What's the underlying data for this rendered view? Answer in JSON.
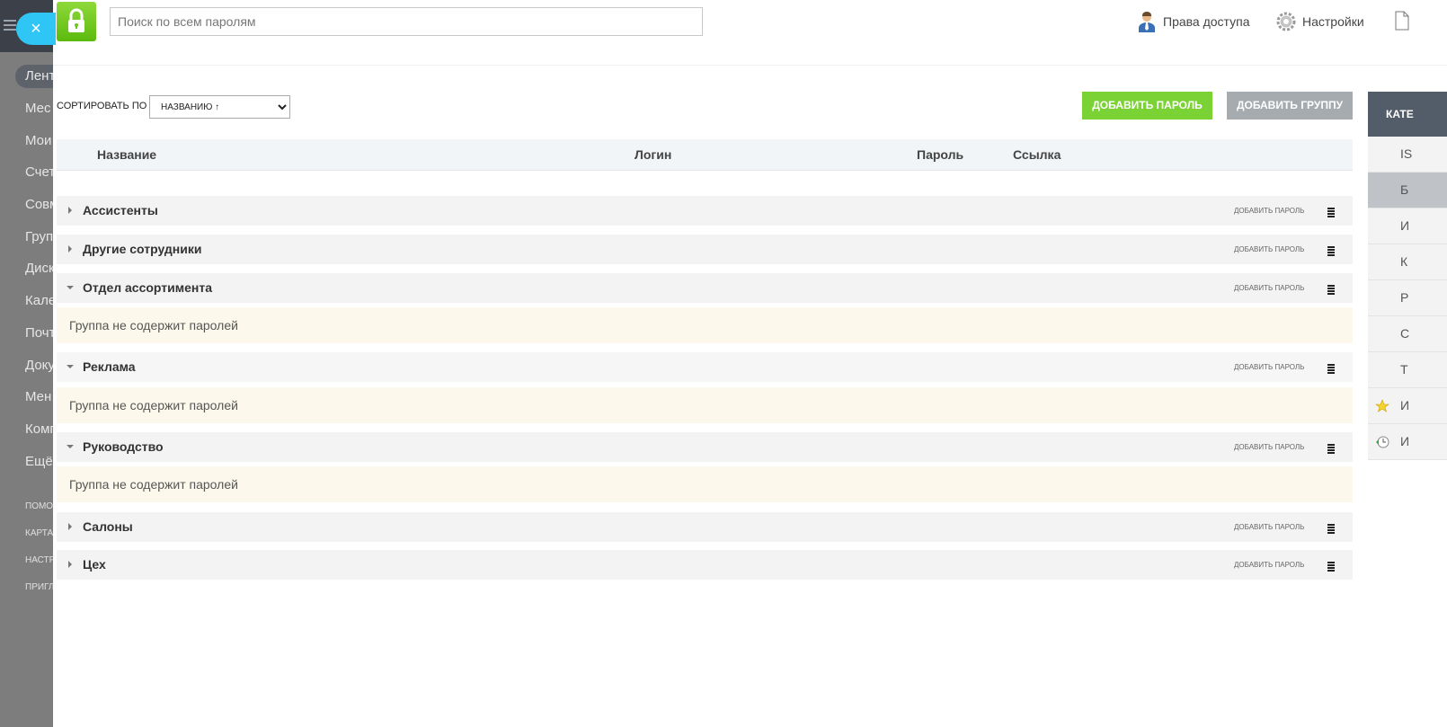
{
  "background_nav": {
    "items": [
      "Лент",
      "Мес",
      "Мои",
      "Счет",
      "Совм",
      "Груп",
      "Диск",
      "Кале",
      "Почт",
      "Доку",
      "Мен",
      "Комп",
      "Ещё"
    ],
    "footer": [
      "ПОМО",
      "КАРТА",
      "НАСТР",
      "ПРИГЛ"
    ]
  },
  "close_label": "×",
  "header": {
    "search_placeholder": "Поиск по всем паролям",
    "access_label": "Права доступа",
    "settings_label": "Настройки"
  },
  "toolbar": {
    "sort_label": "СОРТИРОВАТЬ ПО",
    "sort_value": "НАЗВАНИЮ ↑",
    "add_password": "ДОБАВИТЬ ПАРОЛЬ",
    "add_group": "ДОБАВИТЬ ГРУППУ"
  },
  "table": {
    "columns": [
      "Название",
      "Логин",
      "Пароль",
      "Ссылка"
    ]
  },
  "groups": [
    {
      "name": "Ассистенты",
      "add": "ДОБАВИТЬ ПАРОЛЬ",
      "expanded": false
    },
    {
      "name": "Другие сотрудники",
      "add": "ДОБАВИТЬ ПАРОЛЬ",
      "expanded": false
    },
    {
      "name": "Отдел ассортимента",
      "add": "ДОБАВИТЬ ПАРОЛЬ",
      "expanded": true,
      "empty_text": "Группа не содержит паролей"
    },
    {
      "name": "Реклама",
      "add": "ДОБАВИТЬ ПАРОЛЬ",
      "expanded": true,
      "empty_text": "Группа не содержит паролей"
    },
    {
      "name": "Руководство",
      "add": "ДОБАВИТЬ ПАРОЛЬ",
      "expanded": true,
      "empty_text": "Группа не содержит паролей"
    },
    {
      "name": "Салоны",
      "add": "ДОБАВИТЬ ПАРОЛЬ",
      "expanded": false
    },
    {
      "name": "Цех",
      "add": "ДОБАВИТЬ ПАРОЛЬ",
      "expanded": false
    }
  ],
  "categories": {
    "title": "КАТЕ",
    "items": [
      "IS",
      "Б",
      "И",
      "К",
      "Р",
      "С",
      "Т",
      "И",
      "И"
    ]
  },
  "colors": {
    "accent_green": "#7bd234",
    "accent_blue": "#2fc6f6",
    "category_header": "#535c69"
  }
}
